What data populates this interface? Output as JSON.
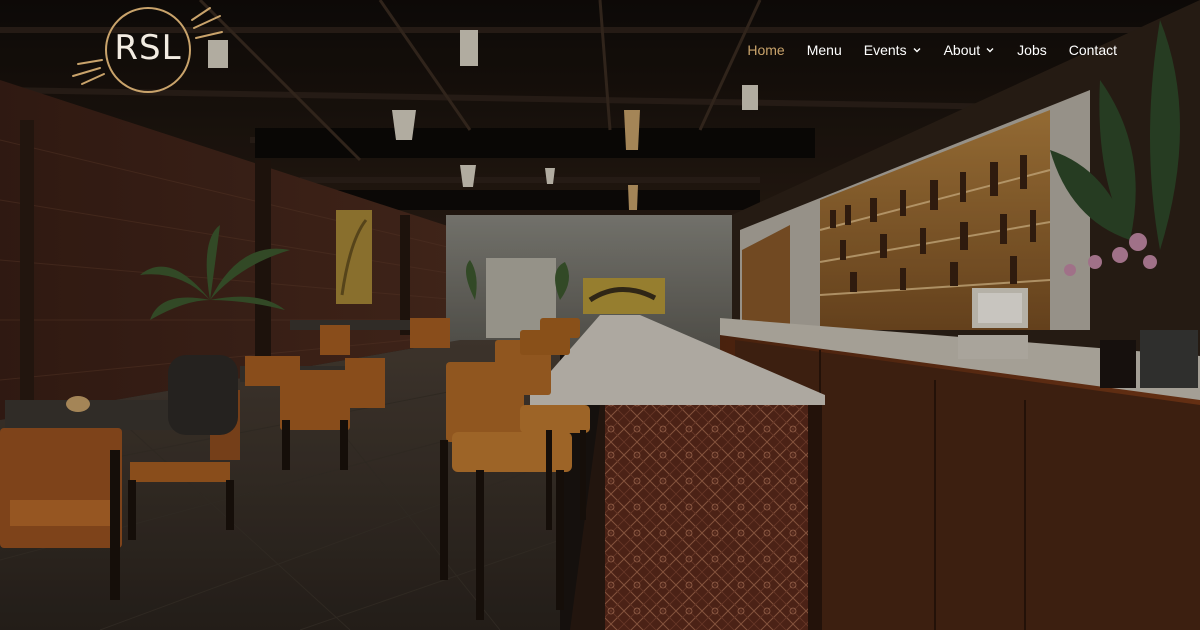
{
  "brand": {
    "logo_text": "RSL"
  },
  "nav": {
    "items": [
      {
        "label": "Home",
        "active": true,
        "has_dropdown": false
      },
      {
        "label": "Menu",
        "active": false,
        "has_dropdown": false
      },
      {
        "label": "Events",
        "active": false,
        "has_dropdown": true
      },
      {
        "label": "About",
        "active": false,
        "has_dropdown": true
      },
      {
        "label": "Jobs",
        "active": false,
        "has_dropdown": false
      },
      {
        "label": "Contact",
        "active": false,
        "has_dropdown": false
      }
    ]
  },
  "colors": {
    "nav_active": "#c9a36b",
    "nav_text": "#ffffff",
    "logo_ring": "#c9a36b"
  },
  "hero": {
    "image_subject": "restaurant-bar-interior"
  }
}
